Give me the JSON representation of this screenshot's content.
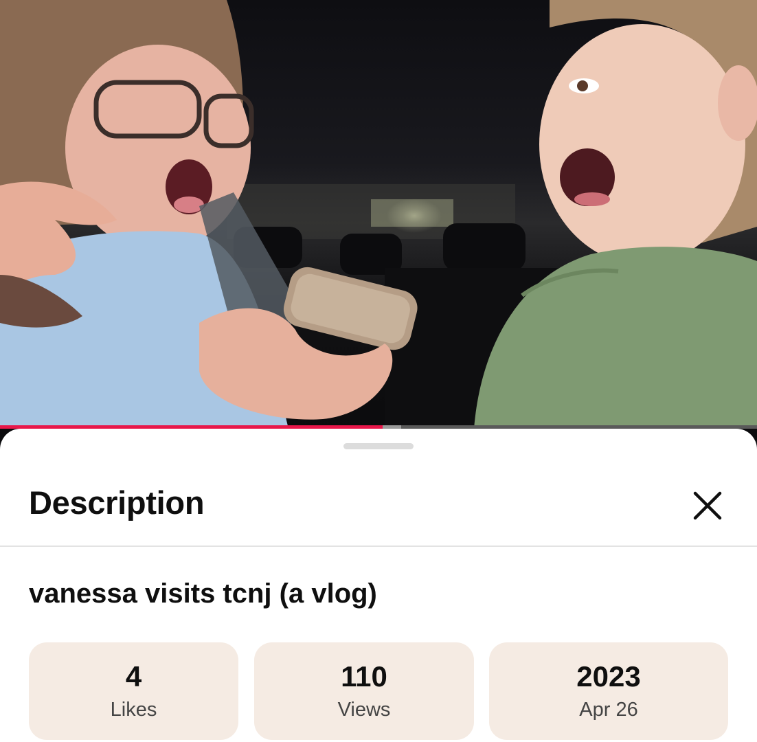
{
  "player": {
    "progress_fraction": 0.505,
    "buffered_fraction": 0.53,
    "progress_color": "#e8174a"
  },
  "description_sheet": {
    "title": "Description",
    "close_icon": "close-icon",
    "video_title": "vanessa visits tcnj (a vlog)",
    "stats": [
      {
        "value": "4",
        "label": "Likes"
      },
      {
        "value": "110",
        "label": "Views"
      },
      {
        "value": "2023",
        "label": "Apr 26"
      }
    ],
    "stat_background": "#f5ebe3"
  }
}
